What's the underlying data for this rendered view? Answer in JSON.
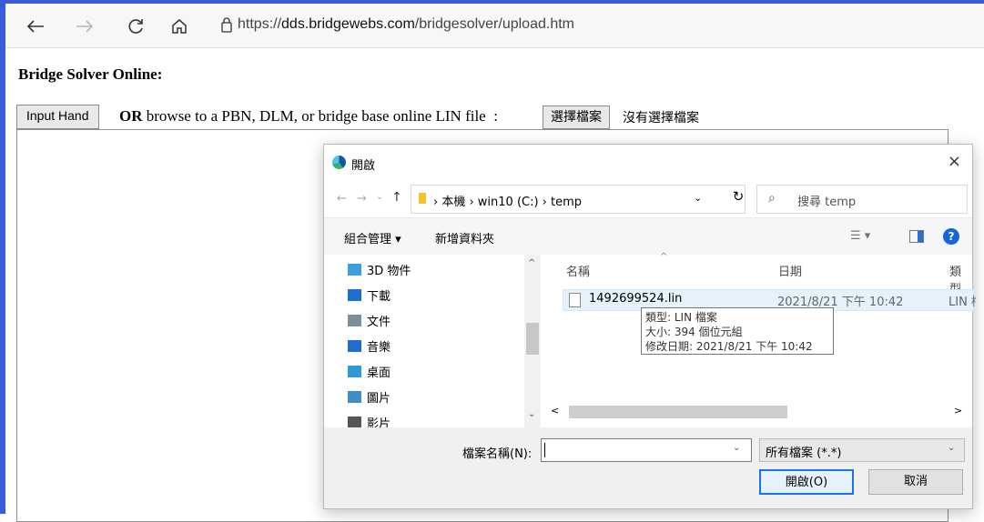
{
  "browser": {
    "url_prefix": "https://",
    "url_host": "dds.bridgewebs.com",
    "url_path": "/bridgesolver/upload.htm"
  },
  "page": {
    "title": "Bridge Solver Online:",
    "input_hand_label": "Input Hand",
    "or_label": "OR",
    "browse_text": " browse to a PBN, DLM, or bridge base online LIN file  :",
    "choose_file_label": "選擇檔案",
    "no_file_text": "沒有選擇檔案"
  },
  "dialog": {
    "title": "開啟",
    "close": "×",
    "breadcrumb": "› 本機 › win10 (C:) › temp",
    "search_placeholder": "搜尋 temp",
    "organize_label": "組合管理 ▾",
    "new_folder_label": "新增資料夾",
    "nav_items": [
      {
        "label": "3D 物件",
        "icon": "3d-objects-icon",
        "color": "#3ca0e0"
      },
      {
        "label": "下載",
        "icon": "download-icon",
        "color": "#1f6fd1"
      },
      {
        "label": "文件",
        "icon": "documents-icon",
        "color": "#7b8e9c"
      },
      {
        "label": "音樂",
        "icon": "music-icon",
        "color": "#1f6fd1"
      },
      {
        "label": "桌面",
        "icon": "desktop-icon",
        "color": "#2f9bd6"
      },
      {
        "label": "圖片",
        "icon": "pictures-icon",
        "color": "#3f8fc6"
      },
      {
        "label": "影片",
        "icon": "videos-icon",
        "color": "#555555"
      }
    ],
    "columns": {
      "name": "名稱",
      "date": "日期",
      "type": "類型"
    },
    "files": [
      {
        "name": "1492699524.lin",
        "date": "2021/8/21 下午 10:42",
        "type": "LIN 檔案"
      }
    ],
    "tooltip": {
      "type": "類型: LIN 檔案",
      "size": "大小: 394 個位元組",
      "modified": "修改日期: 2021/8/21 下午 10:42"
    },
    "filename_label": "檔案名稱(N):",
    "filename_value": "",
    "filter_value": "所有檔案 (*.*)",
    "open_label": "開啟(O)",
    "cancel_label": "取消"
  }
}
